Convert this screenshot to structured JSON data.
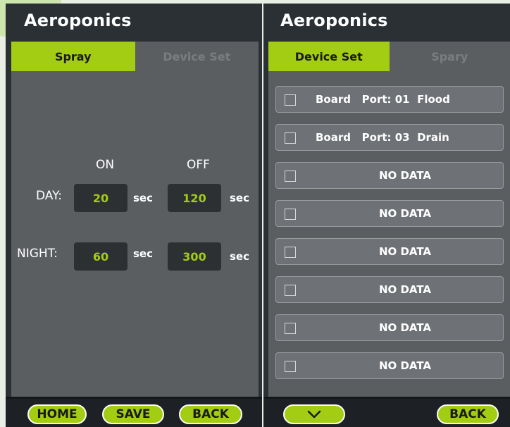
{
  "left_panel": {
    "title": "Aeroponics",
    "tabs": [
      {
        "label": "Spray",
        "active": true
      },
      {
        "label": "Device Set",
        "active": false
      }
    ],
    "spray": {
      "on_label": "ON",
      "off_label": "OFF",
      "unit": "sec",
      "day": {
        "label": "DAY:",
        "on": "20",
        "off": "120"
      },
      "night": {
        "label": "NIGHT:",
        "on": "60",
        "off": "300"
      }
    },
    "footer": {
      "home": "HOME",
      "save": "SAVE",
      "back": "BACK"
    }
  },
  "right_panel": {
    "title": "Aeroponics",
    "tabs": [
      {
        "label": "Device Set",
        "active": true
      },
      {
        "label": "Spary",
        "active": false
      }
    ],
    "devices": [
      {
        "text": "Board   Port: 01  Flood",
        "checked": false
      },
      {
        "text": "Board   Port: 03  Drain",
        "checked": false
      },
      {
        "text": "NO DATA",
        "checked": false
      },
      {
        "text": "NO DATA",
        "checked": false
      },
      {
        "text": "NO DATA",
        "checked": false
      },
      {
        "text": "NO DATA",
        "checked": false
      },
      {
        "text": "NO DATA",
        "checked": false
      },
      {
        "text": "NO DATA",
        "checked": false
      }
    ],
    "footer": {
      "down_icon": "chevron-down-icon",
      "back": "BACK"
    }
  },
  "colors": {
    "accent": "#a3cd12",
    "panel_bg": "#2b3035",
    "content_bg": "#5b5e61",
    "footer_bg": "#1d2125"
  }
}
